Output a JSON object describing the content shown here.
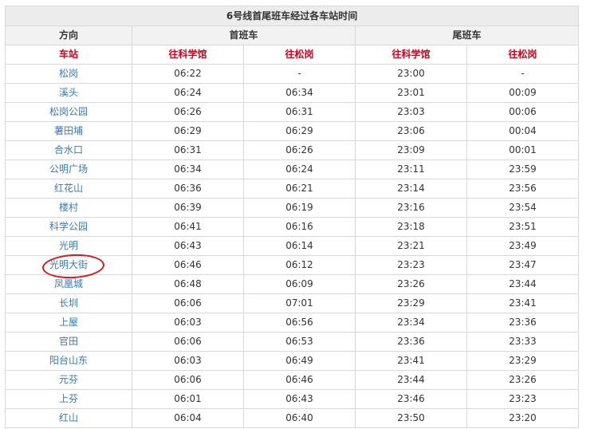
{
  "title": "6号线首尾班车经过各车站时间",
  "header": {
    "direction_label": "方向",
    "first_train_label": "首班车",
    "last_train_label": "尾班车",
    "station_label": "车站",
    "to_kexueguan": "往科学馆",
    "to_songgang": "往松岗"
  },
  "accent_color": "#d0021b",
  "station_color": "#3a78b8",
  "highlighted_station": "光明大街",
  "rows": [
    {
      "station": "松岗",
      "first_kxg": "06:22",
      "first_sg": "-",
      "last_kxg": "23:00",
      "last_sg": "-"
    },
    {
      "station": "溪头",
      "first_kxg": "06:24",
      "first_sg": "06:34",
      "last_kxg": "23:01",
      "last_sg": "00:09"
    },
    {
      "station": "松岗公园",
      "first_kxg": "06:26",
      "first_sg": "06:31",
      "last_kxg": "23:03",
      "last_sg": "00:06"
    },
    {
      "station": "薯田埔",
      "first_kxg": "06:29",
      "first_sg": "06:29",
      "last_kxg": "23:06",
      "last_sg": "00:04"
    },
    {
      "station": "合水口",
      "first_kxg": "06:31",
      "first_sg": "06:26",
      "last_kxg": "23:09",
      "last_sg": "00:01"
    },
    {
      "station": "公明广场",
      "first_kxg": "06:34",
      "first_sg": "06:24",
      "last_kxg": "23:11",
      "last_sg": "23:59"
    },
    {
      "station": "红花山",
      "first_kxg": "06:36",
      "first_sg": "06:21",
      "last_kxg": "23:14",
      "last_sg": "23:56"
    },
    {
      "station": "楼村",
      "first_kxg": "06:39",
      "first_sg": "06:19",
      "last_kxg": "23:16",
      "last_sg": "23:54"
    },
    {
      "station": "科学公园",
      "first_kxg": "06:41",
      "first_sg": "06:16",
      "last_kxg": "23:18",
      "last_sg": "23:51"
    },
    {
      "station": "光明",
      "first_kxg": "06:43",
      "first_sg": "06:14",
      "last_kxg": "23:21",
      "last_sg": "23:49"
    },
    {
      "station": "光明大街",
      "first_kxg": "06:46",
      "first_sg": "06:12",
      "last_kxg": "23:23",
      "last_sg": "23:47"
    },
    {
      "station": "凤凰城",
      "first_kxg": "06:48",
      "first_sg": "06:09",
      "last_kxg": "23:26",
      "last_sg": "23:44"
    },
    {
      "station": "长圳",
      "first_kxg": "06:06",
      "first_sg": "07:01",
      "last_kxg": "23:29",
      "last_sg": "23:41"
    },
    {
      "station": "上屋",
      "first_kxg": "06:03",
      "first_sg": "06:56",
      "last_kxg": "23:34",
      "last_sg": "23:36"
    },
    {
      "station": "官田",
      "first_kxg": "06:06",
      "first_sg": "06:53",
      "last_kxg": "23:36",
      "last_sg": "23:33"
    },
    {
      "station": "阳台山东",
      "first_kxg": "06:03",
      "first_sg": "06:49",
      "last_kxg": "23:41",
      "last_sg": "23:29"
    },
    {
      "station": "元芬",
      "first_kxg": "06:06",
      "first_sg": "06:46",
      "last_kxg": "23:44",
      "last_sg": "23:26"
    },
    {
      "station": "上芬",
      "first_kxg": "06:01",
      "first_sg": "06:43",
      "last_kxg": "23:46",
      "last_sg": "23:23"
    },
    {
      "station": "红山",
      "first_kxg": "06:04",
      "first_sg": "06:40",
      "last_kxg": "23:50",
      "last_sg": "23:20"
    }
  ]
}
